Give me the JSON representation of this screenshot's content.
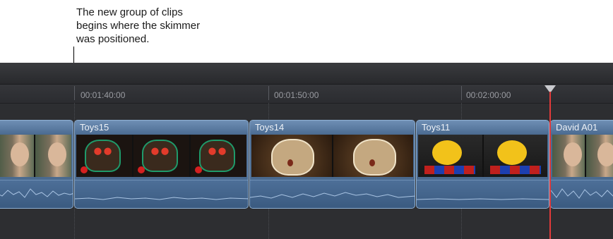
{
  "callout": {
    "lines": [
      "The new group of clips",
      "begins where the skimmer",
      "was positioned."
    ]
  },
  "ruler": {
    "timecodes": [
      "00:01:40:00",
      "00:01:50:00",
      "00:02:00:00"
    ]
  },
  "clips": [
    {
      "title": "",
      "frames": [
        "people",
        "people"
      ]
    },
    {
      "title": "Toys15",
      "frames": [
        "masks",
        "masks",
        "masks"
      ]
    },
    {
      "title": "Toys14",
      "frames": [
        "owl",
        "owl"
      ]
    },
    {
      "title": "Toys11",
      "frames": [
        "toy",
        "toy"
      ]
    },
    {
      "title": "David A01",
      "frames": [
        "people",
        "people"
      ]
    }
  ],
  "colors": {
    "timeline_bg": "#2d2e31",
    "clip_fill": "#4a6a8f",
    "clip_border": "#8fb0d3",
    "playhead": "#e23a3a"
  }
}
